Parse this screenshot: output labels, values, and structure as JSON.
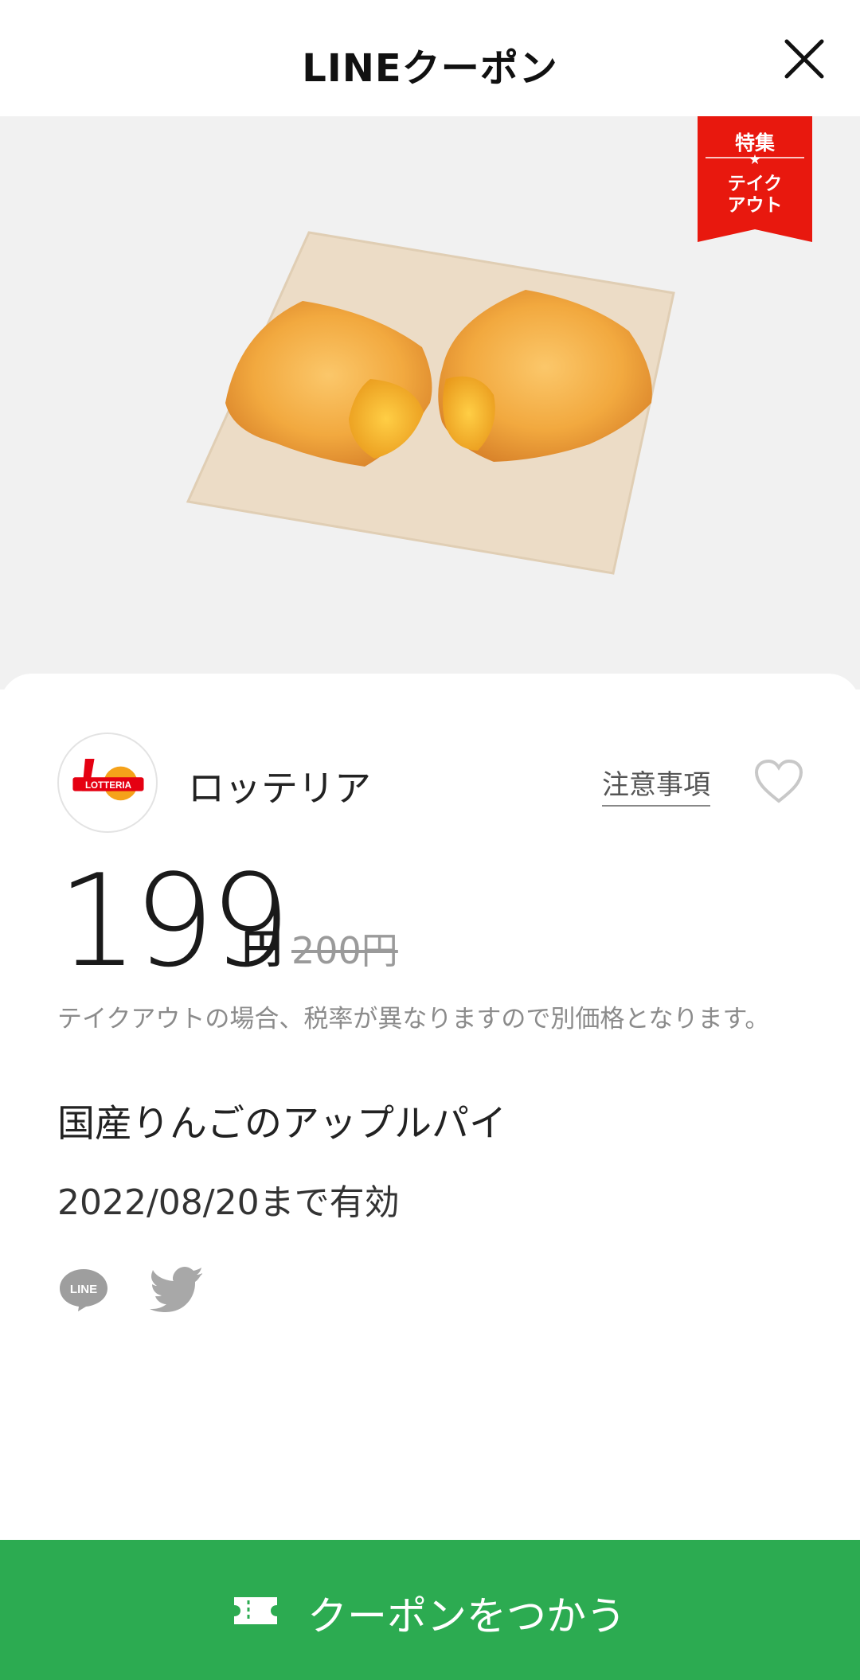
{
  "header": {
    "title": "LINEクーポン",
    "close_icon": "close-icon"
  },
  "hero": {
    "ribbon_top": "特集",
    "ribbon_star": "★",
    "ribbon_bottom": "テイク\nアウト",
    "ribbon_color": "#e8180e"
  },
  "store": {
    "name": "ロッテリア",
    "logo_text": "LOTTERIA",
    "notes_label": "注意事項",
    "favorite_icon": "heart-icon"
  },
  "price": {
    "value": "199",
    "currency": "円",
    "original": "200円"
  },
  "note": "テイクアウトの場合、税率が異なりますので別価格となります。",
  "product_name": "国産りんごのアップルパイ",
  "validity": "2022/08/20まで有効",
  "share": {
    "line_label": "LINE",
    "twitter_icon": "twitter-icon"
  },
  "action": {
    "label": "クーポンをつかう",
    "color": "#2cab51",
    "icon": "ticket-icon"
  }
}
